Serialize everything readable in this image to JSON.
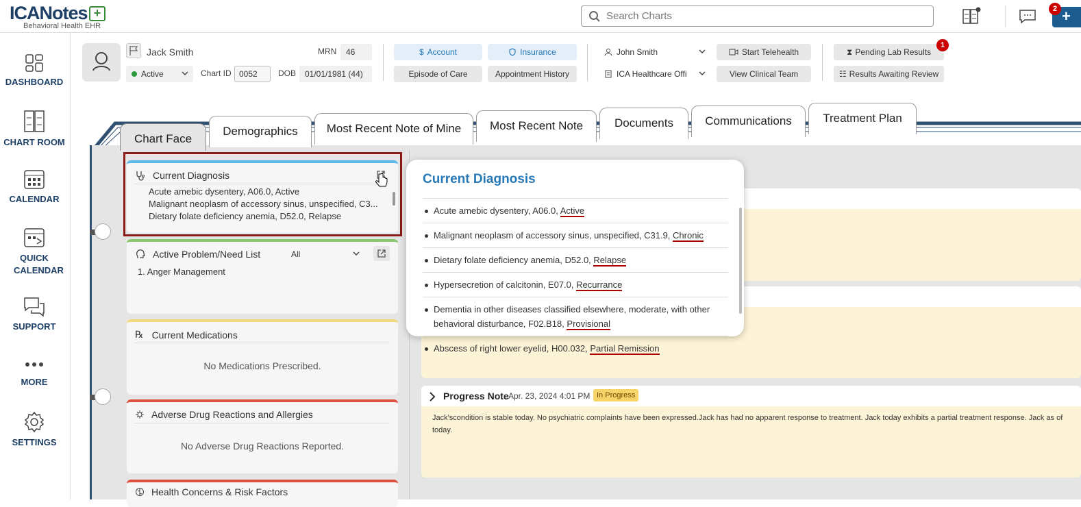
{
  "app": {
    "logo": "ICANotes",
    "logo_sub": "Behavioral Health EHR"
  },
  "search": {
    "placeholder": "Search Charts"
  },
  "badges": {
    "messages": "2",
    "lab": "1"
  },
  "nav": [
    "DASHBOARD",
    "CHART ROOM",
    "CALENDAR",
    "QUICK CALENDAR",
    "SUPPORT",
    "MORE",
    "SETTINGS"
  ],
  "patient": {
    "name": "Jack Smith",
    "status": "Active",
    "chart_id_label": "Chart ID",
    "chart_id": "0052",
    "mrn_label": "MRN",
    "mrn": "46",
    "dob_label": "DOB",
    "dob": "01/01/1981 (44)"
  },
  "actions": {
    "account": "Account",
    "insurance": "Insurance",
    "episode": "Episode of Care",
    "appt": "Appointment History",
    "provider": "John Smith",
    "location": "ICA Healthcare Offi",
    "telehealth": "Start Telehealth",
    "team": "View Clinical Team",
    "lab": "Pending Lab Results",
    "review": "Results Awaiting Review"
  },
  "tabs": [
    "Chart Face",
    "Demographics",
    "Most Recent Note of Mine",
    "Most Recent Note",
    "Documents",
    "Communications",
    "Treatment Plan"
  ],
  "cards": {
    "diagnosis": {
      "title": "Current Diagnosis",
      "items": [
        "Acute amebic dysentery, A06.0, Active",
        "Malignant neoplasm of accessory sinus, unspecified, C3...",
        "Dietary folate deficiency anemia, D52.0, Relapse"
      ]
    },
    "problems": {
      "title": "Active Problem/Need List",
      "filter": "All",
      "items": [
        "1. Anger Management"
      ]
    },
    "meds": {
      "title": "Current Medications",
      "empty": "No Medications Prescribed."
    },
    "adr": {
      "title": "Adverse Drug Reactions and Allergies",
      "empty": "No Adverse Drug Reactions Reported."
    },
    "health": {
      "title": "Health Concerns & Risk Factors"
    }
  },
  "popup": {
    "title": "Current Diagnosis",
    "items": [
      {
        "text": "Acute amebic dysentery, A06.0, ",
        "status": "Active"
      },
      {
        "text": "Malignant neoplasm of accessory sinus, unspecified, C31.9, ",
        "status": "Chronic"
      },
      {
        "text": "Dietary folate deficiency anemia, D52.0, ",
        "status": "Relapse"
      },
      {
        "text": "Hypersecretion of calcitonin, E07.0, ",
        "status": "Recurrance"
      },
      {
        "text": "Dementia in other diseases classified elsewhere, moderate, with other behavioral disturbance, F02.B18, ",
        "status": "Provisional"
      },
      {
        "text": "Abscess of right lower eyelid, H00.032, ",
        "status": "Partial Remission"
      }
    ]
  },
  "note": {
    "title": "Progress Note",
    "date": "Apr. 23, 2024 4:01 PM",
    "status": "In Progress",
    "body": "Jack'scondition is stable today. No psychiatric complaints have been expressed.Jack has had no apparent response to treatment. Jack today exhibits a partial treatment response. Jack as of today."
  }
}
